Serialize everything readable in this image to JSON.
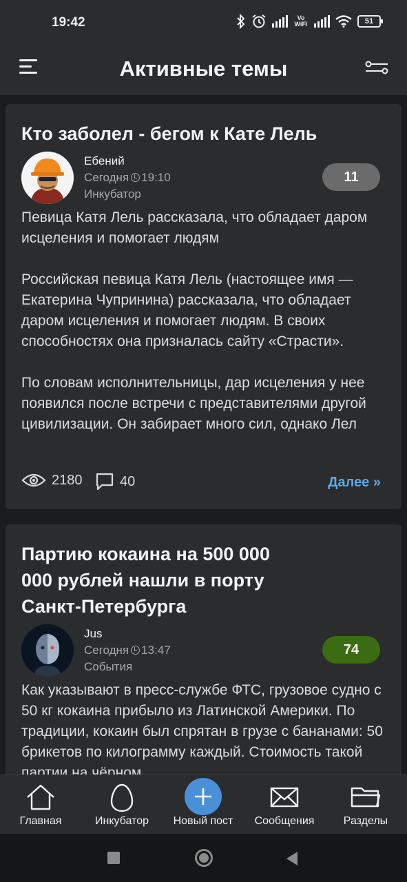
{
  "status_bar": {
    "time": "19:42",
    "network_label": "Vo WiFi",
    "battery": "51"
  },
  "header": {
    "title": "Активные темы"
  },
  "posts": [
    {
      "title": "Кто заболел - бегом к Кате Лель",
      "author": "Ебений",
      "date": "Сегодня",
      "time": "19:10",
      "category": "Инкубатор",
      "rating": "11",
      "rating_color": "#6b6b6b",
      "paragraphs": [
        "Певица Катя Лель рассказала, что обладает даром исцеления и помогает людям",
        "Российская певица Катя Лель (настоящее имя — Екатерина Чупринина) рассказала, что обладает даром исцеления и помогает людям. В своих способностях она призналась сайту «Страсти».",
        "По словам исполнительницы, дар исцеления у нее появился после встречи с представителями другой цивилизации. Он забирает много сил, однако Лел"
      ],
      "views": "2180",
      "comments": "40",
      "more_label": "Далее »"
    },
    {
      "title": "Партию кокаина на 500 000 000 рублей нашли в порту Санкт-Петербурга",
      "author": "Jus",
      "date": "Сегодня",
      "time": "13:47",
      "category": "События",
      "rating": "74",
      "rating_color": "#3b6b12",
      "paragraphs": [
        "Как указывают в пресс-службе ФТС, грузовое судно с 50 кг кокаина прибыло из Латинской Америки. По традиции, кокаин был спрятан в грузе с бананами: 50 брикетов по килограмму каждый. Стоимость такой партии на чёрном"
      ]
    }
  ],
  "bottom_nav": {
    "items": [
      {
        "label": "Главная",
        "icon": "home-icon"
      },
      {
        "label": "Инкубатор",
        "icon": "egg-icon"
      },
      {
        "label": "Новый пост",
        "icon": "plus-icon"
      },
      {
        "label": "Сообщения",
        "icon": "envelope-icon"
      },
      {
        "label": "Разделы",
        "icon": "folder-icon"
      }
    ],
    "fab_color": "#4a90d9"
  },
  "colors": {
    "background": "#1b1c1e",
    "card": "#2b2c2e",
    "link": "#5aa9e6"
  }
}
